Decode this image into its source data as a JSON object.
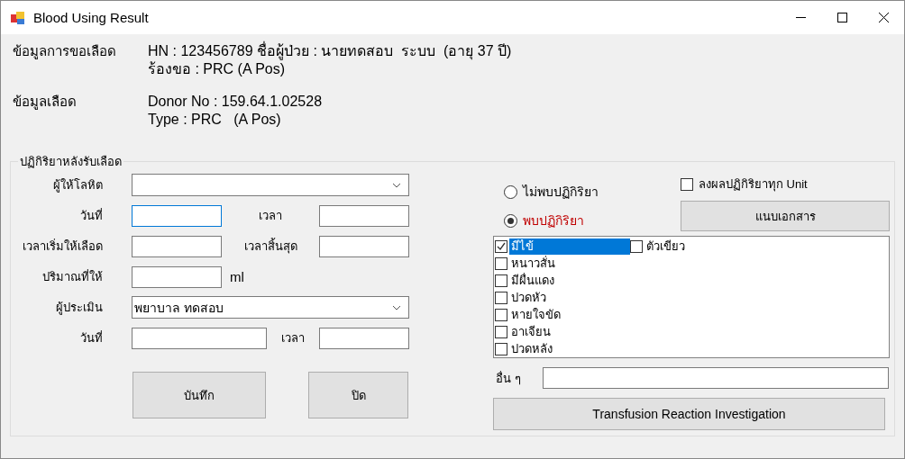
{
  "window": {
    "title": "Blood Using Result"
  },
  "info": [
    {
      "label": "ข้อมูลการขอเลือด",
      "lines": [
        "HN : 123456789 ชื่อผู้ป่วย : นายทดสอบ  ระบบ  (อายุ 37 ปี)",
        "ร้องขอ : PRC (A Pos)"
      ]
    },
    {
      "label": "ข้อมูลเลือด",
      "lines": [
        "Donor No : 159.64.1.02528",
        "Type : PRC   (A Pos)"
      ]
    }
  ],
  "reaction_group": {
    "title": "ปฏิกิริยาหลังรับเลือด",
    "rows": [
      {
        "kind": "combo",
        "label": "ผู้ให้โลหิต"
      },
      {
        "kind": "pair",
        "label": "วันที่",
        "second_label": "เวลา",
        "focused": true
      },
      {
        "kind": "pair",
        "label": "เวลาเริ่มให้เลือด",
        "second_label": "เวลาสิ้นสุด",
        "focused": false
      },
      {
        "kind": "amount",
        "label": "ปริมาณที่ให้",
        "unit": "ml"
      },
      {
        "kind": "combo",
        "label": "ผู้ประเมิน",
        "value": "พยาบาล ทดสอบ"
      },
      {
        "kind": "pair_wide",
        "label": "วันที่",
        "second_label": "เวลา",
        "focused": false
      }
    ],
    "buttons": [
      "บันทึก",
      "ปิด"
    ],
    "result_options": [
      {
        "label": "ไม่พบปฏิกิริยา",
        "selected": false
      },
      {
        "label": "พบปฏิกิริยา",
        "selected": true
      }
    ],
    "all_units": {
      "label": "ลงผลปฏิกิริยาทุก Unit",
      "checked": false
    },
    "attach_button": "แนบเอกสาร",
    "reactions": [
      {
        "label": "มีไข้",
        "checked": true,
        "selected": true
      },
      {
        "label": "หนาวสั่น",
        "checked": false,
        "selected": false
      },
      {
        "label": "มีผื่นแดง",
        "checked": false,
        "selected": false
      },
      {
        "label": "ปวดหัว",
        "checked": false,
        "selected": false
      },
      {
        "label": "หายใจขัด",
        "checked": false,
        "selected": false
      },
      {
        "label": "อาเจียน",
        "checked": false,
        "selected": false
      },
      {
        "label": "ปวดหลัง",
        "checked": false,
        "selected": false
      },
      {
        "label": "ตัวเขียว",
        "checked": false,
        "selected": false
      }
    ],
    "other_label": "อื่น ๆ",
    "investigation_button": "Transfusion Reaction Investigation"
  }
}
